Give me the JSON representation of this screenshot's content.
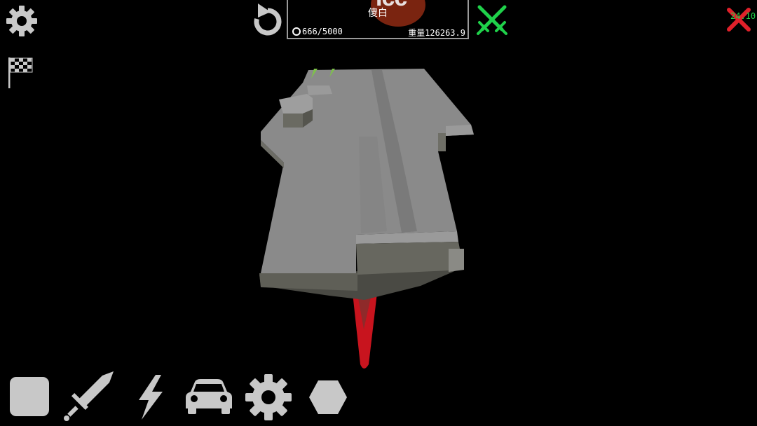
{
  "hud": {
    "player_name": "傻白",
    "avatar_text": "Icc",
    "coins": "666/5000",
    "weight": "重量126263.9",
    "timer": "24.10"
  },
  "icons": {
    "settings": "gear-icon",
    "undo": "undo-icon",
    "battle": "crossed-swords-icon",
    "close": "close-x-icon",
    "race": "checkered-flag-icon"
  },
  "toolbar": [
    {
      "name": "block-category-button",
      "icon": "square-icon"
    },
    {
      "name": "weapon-category-button",
      "icon": "sword-icon"
    },
    {
      "name": "power-category-button",
      "icon": "lightning-icon"
    },
    {
      "name": "vehicle-category-button",
      "icon": "car-icon"
    },
    {
      "name": "mechanism-category-button",
      "icon": "gear-icon"
    },
    {
      "name": "shape-category-button",
      "icon": "hexagon-icon"
    }
  ],
  "colors": {
    "icon_gray": "#c8c8c8",
    "accent_green": "#1fd14a",
    "close_red": "#e0202a",
    "deck_top": "#8b8b8b",
    "deck_side": "#5c5c55",
    "rudder_red": "#c8141e"
  }
}
